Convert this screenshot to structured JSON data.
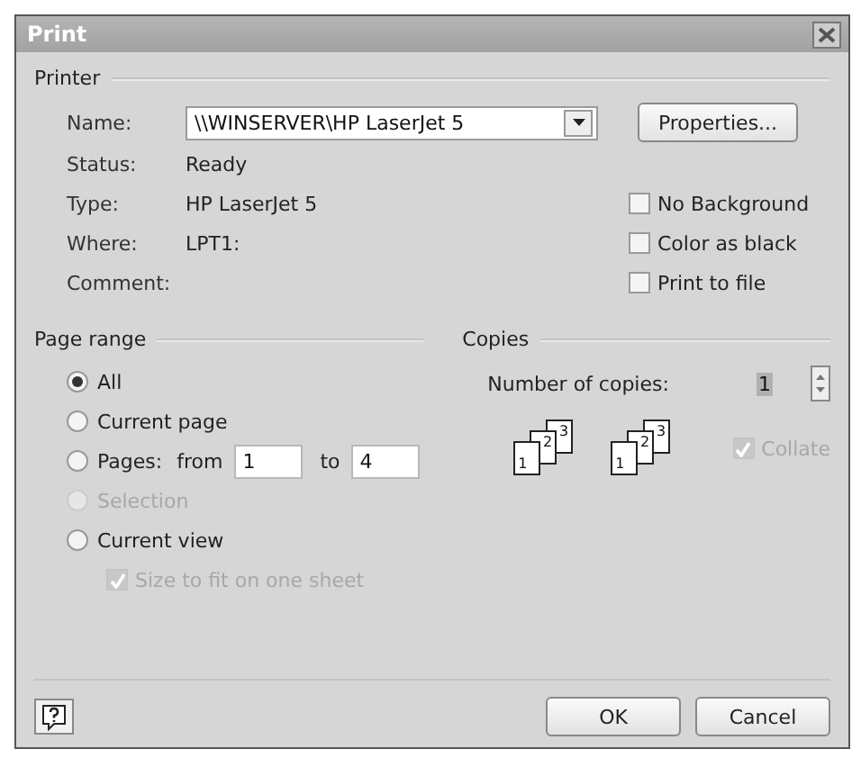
{
  "window": {
    "title": "Print"
  },
  "printer": {
    "title": "Printer",
    "name_label": "Name:",
    "name_value": "\\\\WINSERVER\\HP LaserJet 5",
    "properties": "Properties...",
    "info": [
      {
        "label": "Status:",
        "value": "Ready"
      },
      {
        "label": "Type:",
        "value": "HP LaserJet 5"
      },
      {
        "label": "Where:",
        "value": "LPT1:"
      },
      {
        "label": "Comment:"
      }
    ],
    "options": [
      {
        "label": "No Background",
        "checked": false
      },
      {
        "label": "Color as black",
        "checked": false
      },
      {
        "label": "Print to file",
        "checked": false
      }
    ]
  },
  "page_range": {
    "title": "Page range",
    "options": [
      {
        "kind": "plain",
        "label": "All",
        "selected": true,
        "disabled": false
      },
      {
        "kind": "plain",
        "label": "Current page",
        "selected": false,
        "disabled": false
      },
      {
        "kind": "pages",
        "label": "Pages:",
        "from_label": "from",
        "from_value": "1",
        "to_label": "to",
        "to_value": "4",
        "selected": false,
        "disabled": false
      },
      {
        "kind": "plain",
        "label": "Selection",
        "selected": false,
        "disabled": true
      },
      {
        "kind": "plain",
        "label": "Current view",
        "selected": false,
        "disabled": false
      }
    ],
    "fit": {
      "label": "Size to fit on one sheet",
      "checked": true,
      "disabled": true
    }
  },
  "copies": {
    "title": "Copies",
    "label": "Number of copies:",
    "value": "1",
    "sets": [
      [
        "1",
        "2",
        "3"
      ],
      [
        "1",
        "2",
        "3"
      ]
    ],
    "collate": {
      "label": "Collate",
      "checked": true,
      "disabled": true
    }
  },
  "buttons": [
    "OK",
    "Cancel"
  ]
}
